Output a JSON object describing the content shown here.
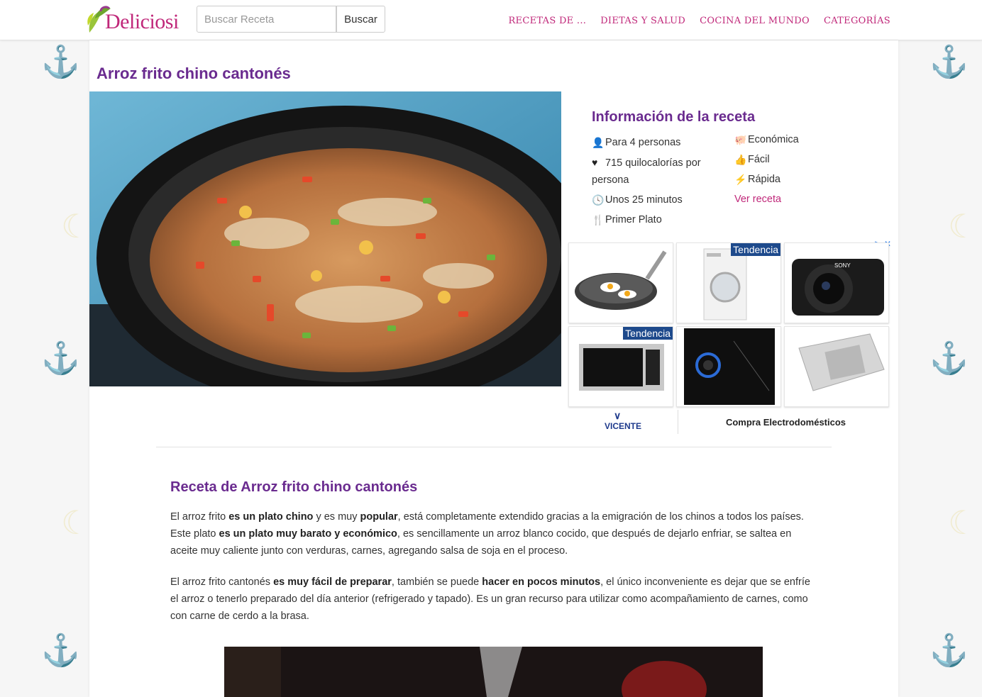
{
  "header": {
    "logo_text": "Deliciosi",
    "search_placeholder": "Buscar Receta",
    "search_button": "Buscar",
    "nav": [
      "RECETAS DE ...",
      "DIETAS Y SALUD",
      "COCINA DEL MUNDO",
      "CATEGORÍAS"
    ]
  },
  "recipe": {
    "title": "Arroz frito chino cantonés",
    "hero_image": "fried-rice-in-wok"
  },
  "info": {
    "title": "Información de la receta",
    "left": [
      {
        "icon": "user-icon",
        "text": "Para 4 personas"
      },
      {
        "icon": "heart-icon",
        "text": "715 quilocalorías por persona"
      },
      {
        "icon": "clock-icon",
        "text": "Unos 25 minutos"
      },
      {
        "icon": "cutlery-icon",
        "text": "Primer Plato"
      }
    ],
    "right": [
      {
        "icon": "piggy-bank-icon",
        "text": "Económica"
      },
      {
        "icon": "thumbs-up-icon",
        "text": "Fácil"
      },
      {
        "icon": "bolt-icon",
        "text": "Rápida"
      }
    ],
    "link": "Ver receta"
  },
  "ads": {
    "badge": "Tendencia",
    "products": [
      "frying-pan",
      "washing-machine",
      "camera",
      "microwave",
      "gas-hob",
      "steel-sink"
    ],
    "camera_brand": "SONY",
    "brand_name": "VICENTE",
    "cta": "Compra Electrodomésticos"
  },
  "article": {
    "section_title": "Receta de Arroz frito chino cantonés",
    "p1": [
      {
        "t": "El arroz frito ",
        "b": false
      },
      {
        "t": "es un plato chino",
        "b": true
      },
      {
        "t": " y es muy ",
        "b": false
      },
      {
        "t": "popular",
        "b": true
      },
      {
        "t": ", está completamente extendido gracias a la emigración de los chinos a todos los países. Este plato ",
        "b": false
      },
      {
        "t": "es un plato muy barato y económico",
        "b": true
      },
      {
        "t": ", es sencillamente un arroz blanco cocido, que después de dejarlo enfriar, se saltea en aceite muy caliente junto con verduras, carnes, agregando salsa de soja en el proceso.",
        "b": false
      }
    ],
    "p2": [
      {
        "t": "El arroz frito cantonés ",
        "b": false
      },
      {
        "t": "es muy fácil de preparar",
        "b": true
      },
      {
        "t": ", también se puede ",
        "b": false
      },
      {
        "t": "hacer en pocos minutos",
        "b": true
      },
      {
        "t": ", el único inconveniente es dejar que se enfríe el arroz o tenerlo preparado del día anterior (refrigerado y tapado). Es un gran recurso para utilizar como acompañamiento de carnes, como con carne de cerdo a la brasa.",
        "b": false
      }
    ]
  },
  "colors": {
    "brand": "#c0287a",
    "title_purple": "#6a2b8f",
    "ad_badge": "#1e4a8c"
  }
}
